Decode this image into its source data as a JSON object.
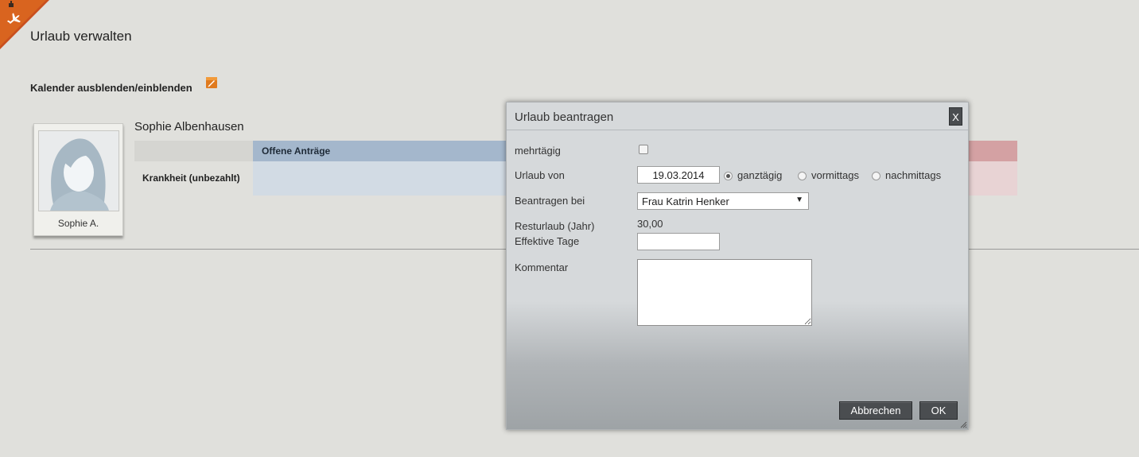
{
  "page": {
    "title": "Urlaub verwalten",
    "toggle_calendar_label": "Kalender ausblenden/einblenden"
  },
  "corner_icon": "airplane-icon",
  "employee": {
    "name": "Sophie Albenhausen",
    "card_caption": "Sophie A."
  },
  "table": {
    "open_requests_header": "Offene Anträge",
    "row_label": "Krankheit (unbezahlt)"
  },
  "dialog": {
    "title": "Urlaub beantragen",
    "close_label": "X",
    "multi_day_label": "mehrtägig",
    "multi_day_checked": false,
    "from_label": "Urlaub von",
    "from_value": "19.03.2014",
    "day_options": [
      "ganztägig",
      "vormittags",
      "nachmittags"
    ],
    "day_selected": "ganztägig",
    "request_to_label": "Beantragen bei",
    "request_to_value": "Frau Katrin Henker",
    "remaining_label": "Resturlaub (Jahr)",
    "remaining_value": "30,00",
    "effective_days_label": "Effektive Tage",
    "effective_days_value": "",
    "comment_label": "Kommentar",
    "comment_value": "",
    "cancel_label": "Abbrechen",
    "ok_label": "OK"
  },
  "colors": {
    "accent_orange": "#d9541a",
    "header_blue": "#a4b7cc",
    "cell_blue": "#d2dbe4",
    "header_red": "#d4a1a3",
    "button_dark": "#4a4d50"
  }
}
